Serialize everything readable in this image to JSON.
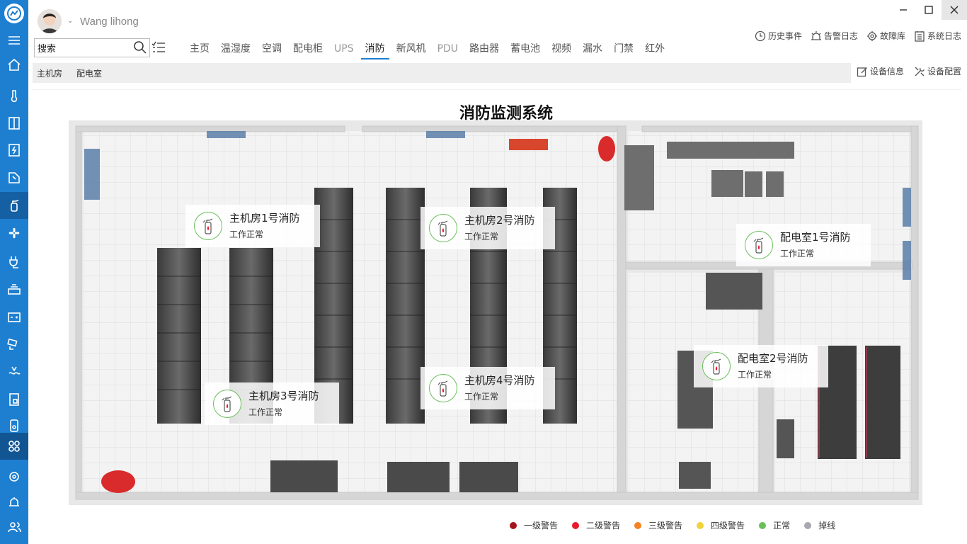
{
  "user": {
    "name": "Wang lihong"
  },
  "search": {
    "placeholder": "搜索",
    "value": "搜索"
  },
  "tabs": [
    {
      "label": "主页"
    },
    {
      "label": "温湿度"
    },
    {
      "label": "空调"
    },
    {
      "label": "配电柜"
    },
    {
      "label": "UPS"
    },
    {
      "label": "消防"
    },
    {
      "label": "新风机"
    },
    {
      "label": "PDU"
    },
    {
      "label": "路由器"
    },
    {
      "label": "蓄电池"
    },
    {
      "label": "视频"
    },
    {
      "label": "漏水"
    },
    {
      "label": "门禁"
    },
    {
      "label": "红外"
    }
  ],
  "active_tab": "消防",
  "top_actions": {
    "history": "历史事件",
    "alarm_log": "告警日志",
    "fault_lib": "故障库",
    "sys_log": "系统日志"
  },
  "breadcrumb": [
    "主机房",
    "配电室"
  ],
  "device_actions": {
    "info": "设备信息",
    "config": "设备配置"
  },
  "page": {
    "title": "消防监测系统"
  },
  "fire_units": [
    {
      "name": "主机房1号消防",
      "status": "工作正常"
    },
    {
      "name": "主机房2号消防",
      "status": "工作正常"
    },
    {
      "name": "配电室1号消防",
      "status": "工作正常"
    },
    {
      "name": "配电室2号消防",
      "status": "工作正常"
    },
    {
      "name": "主机房3号消防",
      "status": "工作正常"
    },
    {
      "name": "主机房4号消防",
      "status": "工作正常"
    }
  ],
  "legend": [
    {
      "label": "一级警告",
      "color": "#a3141a"
    },
    {
      "label": "二级警告",
      "color": "#e8192c"
    },
    {
      "label": "三级警告",
      "color": "#f58220"
    },
    {
      "label": "四级警告",
      "color": "#f0d23c"
    },
    {
      "label": "正常",
      "color": "#6abf5a"
    },
    {
      "label": "掉线",
      "color": "#a8a8b0"
    }
  ],
  "colors": {
    "accent": "#1e7fd0",
    "sidebar": "#1e7fd0",
    "normal": "#6abf5a"
  }
}
